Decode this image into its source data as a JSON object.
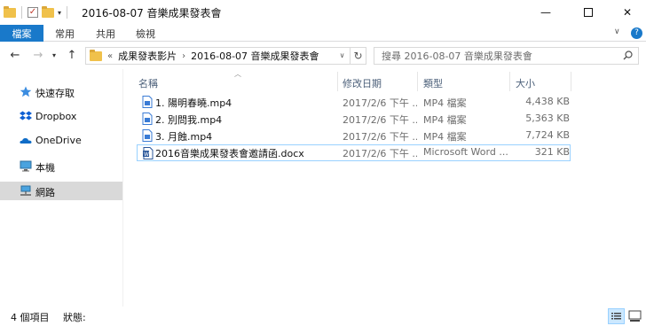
{
  "window": {
    "title": "2016-08-07 音樂成果發表會",
    "minimize_glyph": "—",
    "close_glyph": "✕"
  },
  "quick_access": {
    "icons": [
      "folder-icon",
      "properties-checkbox-icon",
      "new-folder-icon",
      "customize-dropdown-icon"
    ],
    "dropdown_glyph": "▾"
  },
  "ribbon": {
    "file_tab": "檔案",
    "tabs": [
      "常用",
      "共用",
      "檢視"
    ],
    "collapse_glyph": "∨",
    "help_glyph": "?",
    "accent_color": "#1979ca"
  },
  "address": {
    "overflow": "«",
    "segments": [
      "成果發表影片",
      "2016-08-07 音樂成果發表會"
    ],
    "separator": "›",
    "refresh_glyph": "↻"
  },
  "search": {
    "placeholder": "搜尋 2016-08-07 音樂成果發表會"
  },
  "nav_pane": {
    "items": [
      {
        "label": "快速存取",
        "icon": "star-icon"
      },
      {
        "label": "Dropbox",
        "icon": "dropbox-icon"
      },
      {
        "label": "OneDrive",
        "icon": "onedrive-cloud-icon"
      },
      {
        "label": "本機",
        "icon": "computer-icon"
      },
      {
        "label": "網路",
        "icon": "network-icon",
        "selected": true
      }
    ]
  },
  "columns": {
    "name": "名稱",
    "modified": "修改日期",
    "type": "類型",
    "size": "大小"
  },
  "files": [
    {
      "name": "1. 陽明春曉.mp4",
      "modified": "2017/2/6 下午 ...",
      "type": "MP4 檔案",
      "size": "4,438 KB",
      "icon": "video-file-icon"
    },
    {
      "name": "2. 別問我.mp4",
      "modified": "2017/2/6 下午 ...",
      "type": "MP4 檔案",
      "size": "5,363 KB",
      "icon": "video-file-icon"
    },
    {
      "name": "3. 月蝕.mp4",
      "modified": "2017/2/6 下午 ...",
      "type": "MP4 檔案",
      "size": "7,724 KB",
      "icon": "video-file-icon"
    },
    {
      "name": "2016音樂成果發表會邀請函.docx",
      "modified": "2017/2/6 下午 ...",
      "type": "Microsoft Word ...",
      "size": "321 KB",
      "icon": "word-document-icon",
      "focused": true
    }
  ],
  "status": {
    "item_count": "4 個項目",
    "state_label": "狀態:"
  }
}
